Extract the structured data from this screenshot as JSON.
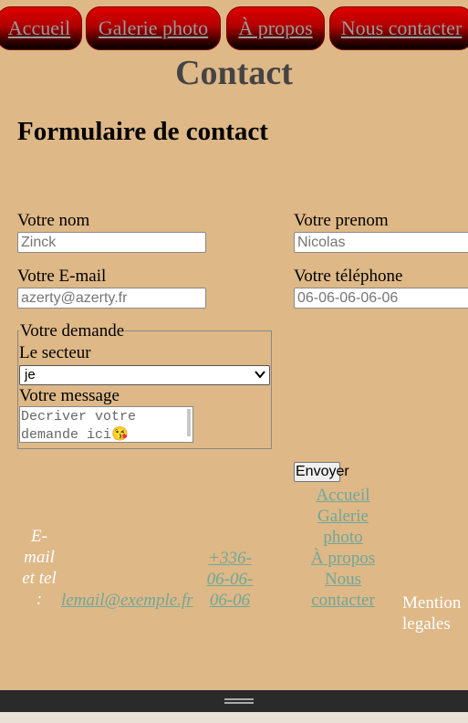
{
  "nav": {
    "items": [
      {
        "label": "Accueil"
      },
      {
        "label": "Galerie photo"
      },
      {
        "label": "À propos"
      },
      {
        "label": "Nous contacter"
      }
    ]
  },
  "page": {
    "title": "Contact"
  },
  "form": {
    "title": "Formulaire de contact",
    "nom": {
      "label": "Votre nom",
      "placeholder": "Zinck"
    },
    "prenom": {
      "label": "Votre prenom",
      "placeholder": "Nicolas"
    },
    "email": {
      "label": "Votre E-mail",
      "placeholder": "azerty@azerty.fr"
    },
    "telephone": {
      "label": "Votre téléphone",
      "placeholder": "06-06-06-06-06"
    },
    "demande": {
      "legend": "Votre demande",
      "secteur_label": "Le secteur",
      "secteur_value": "je",
      "message_label": "Votre message",
      "message_placeholder": "Decriver votre demande ici😘"
    },
    "submit_label": "Envoyer"
  },
  "footer": {
    "contact_label_lines": [
      "E-",
      "mail",
      "et tel",
      ":"
    ],
    "email": "lemail@exemple.fr",
    "phone_lines": [
      "+336-",
      "06-06-",
      "06-06"
    ],
    "links_lines": [
      "Accueil",
      "Galerie",
      "photo",
      "À propos",
      "Nous",
      "contacter"
    ],
    "mention_lines": [
      "Mention",
      "legales"
    ]
  },
  "colors": {
    "background": "#deb887",
    "nav_red": "#e00000",
    "link": "#6fa79a",
    "title_gray": "#444444"
  }
}
